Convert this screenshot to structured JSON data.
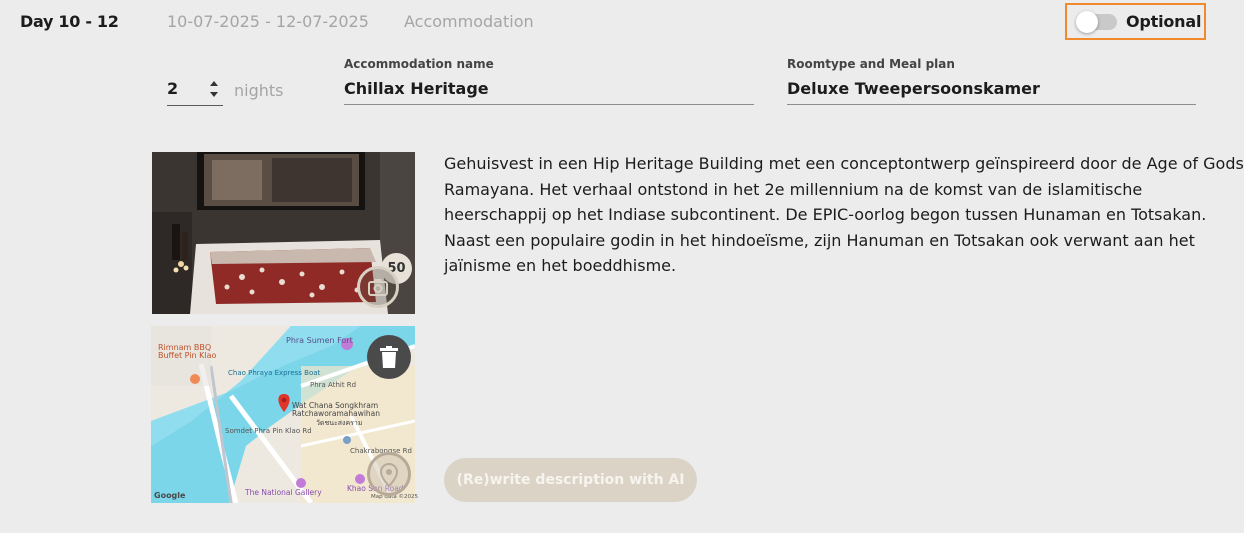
{
  "header": {
    "day_label": "Day 10 - 12",
    "dates": "10-07-2025 - 12-07-2025",
    "type": "Accommodation",
    "optional_label": "Optional",
    "optional_enabled": false
  },
  "nights": {
    "value": "2",
    "label": "nights"
  },
  "accommodation": {
    "label": "Accommodation name",
    "value": "Chillax Heritage"
  },
  "room": {
    "label": "Roomtype and Meal plan",
    "value": "Deluxe Tweepersoonskamer"
  },
  "photo": {
    "count": "50"
  },
  "map": {
    "labels": {
      "restaurant": "Rimnam BBQ\nBuffet Pin Klao",
      "fort": "Phra Sumen Fort",
      "boat": "Chao Phraya Express Boat",
      "road1": "Phra Athit Rd",
      "temple": "Wat Chana Songkhram\nRatchaworamahawihan",
      "thai": "วัดชนะสงคราม",
      "road2": "Somdet Phra Pin Klao Rd",
      "road3": "Chakrabongse Rd",
      "gallery": "The National Gallery",
      "khaosan": "Khao San Road",
      "google": "Google",
      "mapdata": "Map data ©2025"
    }
  },
  "description": "Gehuisvest in een Hip Heritage Building met een conceptontwerp geïnspireerd door de Age of Gods Ramayana. Het verhaal ontstond in het 2e millennium na de komst van de islamitische heerschappij op het Indiase subcontinent. De EPIC-oorlog begon tussen Hunaman en Totsakan. Naast een populaire godin in het hindoeïsme, zijn Hanuman en Totsakan ook verwant aan het jaïnisme en het boeddhisme.",
  "ai_button": {
    "label": "(Re)write description with AI"
  },
  "colors": {
    "accent_orange": "#f08a2c",
    "background": "#ececec",
    "muted_text": "#a5a5a5",
    "ai_button": "#dcd3c7"
  }
}
